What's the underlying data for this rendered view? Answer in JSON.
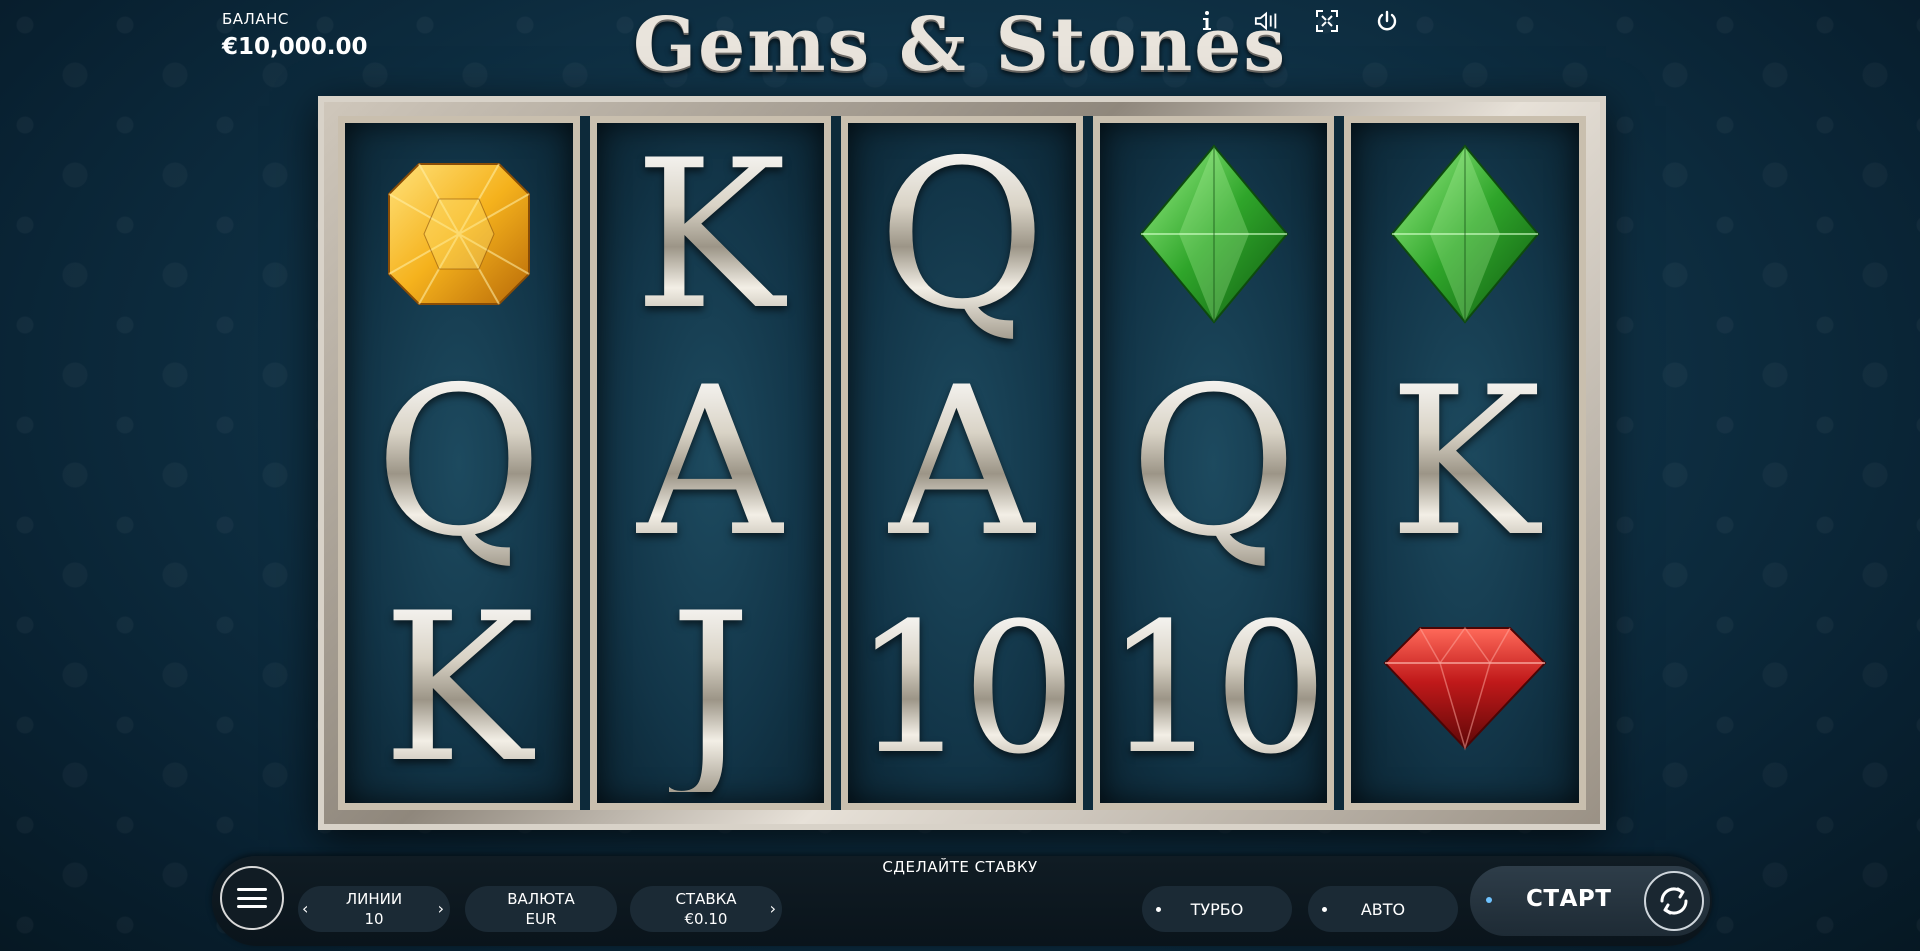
{
  "header": {
    "balance_label": "БАЛАНС",
    "balance_value": "€10,000.00",
    "title": "Gems & Stones",
    "icons": [
      "info-icon",
      "sound-icon",
      "fullscreen-icon",
      "power-icon"
    ]
  },
  "reels": [
    [
      "gem-yellow",
      "Q",
      "K"
    ],
    [
      "K",
      "A",
      "J"
    ],
    [
      "Q",
      "A",
      "10"
    ],
    [
      "gem-green",
      "Q",
      "10"
    ],
    [
      "gem-green",
      "K",
      "gem-red"
    ]
  ],
  "colors": {
    "gem_yellow": "#f5b21d",
    "gem_green": "#2fa52a",
    "gem_red": "#c0191a",
    "frame_silver": "#d8d2c8",
    "background": "#0f3145"
  },
  "controls": {
    "message": "СДЕЛАЙТЕ СТАВКУ",
    "lines_label": "ЛИНИИ",
    "lines_value": "10",
    "currency_label": "ВАЛЮТА",
    "currency_value": "EUR",
    "bet_label": "СТАВКА",
    "bet_value": "€0.10",
    "turbo_label": "ТУРБО",
    "auto_label": "АВТО",
    "start_label": "СТАРТ"
  }
}
